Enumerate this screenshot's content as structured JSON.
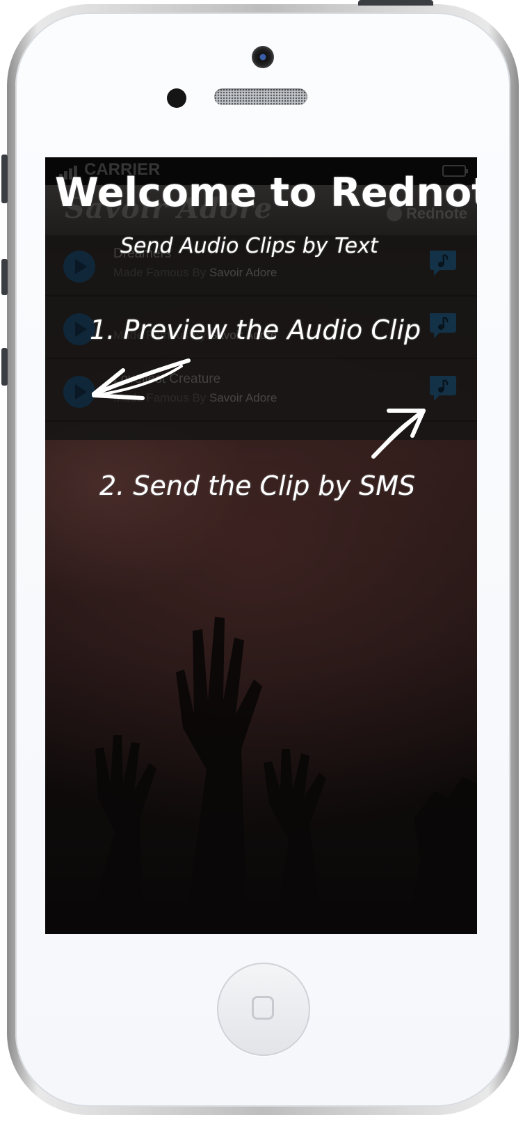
{
  "status_bar": {
    "carrier": "CARRIER"
  },
  "app_header": {
    "artist_logo": "Savoir Adore",
    "brand": "Rednote"
  },
  "songs": [
    {
      "title": "Dreamers",
      "made_famous_by": "Made Famous By",
      "artist": "Savoir Adore"
    },
    {
      "title": "",
      "made_famous_by": "Made Famous By",
      "artist": "Savoir Adore"
    },
    {
      "title": "Loveliest Creature",
      "made_famous_by": "Made Famous By",
      "artist": "Savoir Adore"
    }
  ],
  "overlay": {
    "welcome": "Welcome to Rednote!",
    "tagline": "Send Audio Clips by Text",
    "step1": "1. Preview the Audio Clip",
    "step2": "2. Send the Clip by SMS"
  },
  "colors": {
    "play_accent": "#16364f",
    "sms_accent": "#1d4663"
  }
}
